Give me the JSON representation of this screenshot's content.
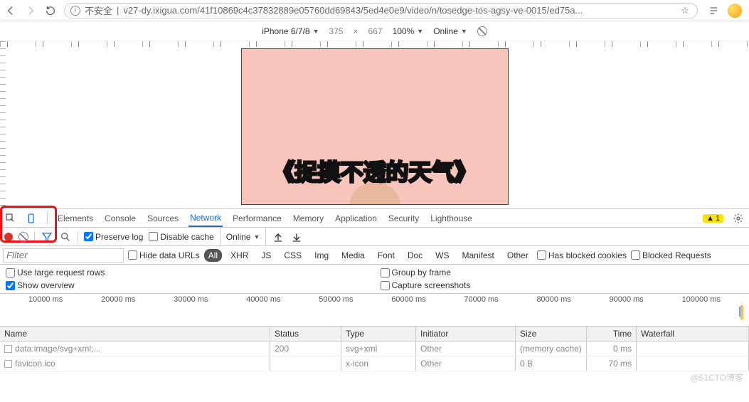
{
  "browser": {
    "insecure": "不安全",
    "url": "v27-dy.ixigua.com/41f10869c4c37832889e05760dd69843/5ed4e0e9/video/n/tosedge-tos-agsy-ve-0015/ed75a..."
  },
  "device_bar": {
    "device": "iPhone 6/7/8",
    "w": "375",
    "h": "667",
    "zoom": "100%",
    "throttle": "Online"
  },
  "video": {
    "title": "《捉摸不透的天气》"
  },
  "tabs": [
    "Elements",
    "Console",
    "Sources",
    "Network",
    "Performance",
    "Memory",
    "Application",
    "Security",
    "Lighthouse"
  ],
  "active_tab": "Network",
  "warn_count": "1",
  "controls": {
    "preserve": "Preserve log",
    "disable_cache": "Disable cache",
    "throttle": "Online"
  },
  "filter": {
    "placeholder": "Filter",
    "hide_data_urls": "Hide data URLs",
    "types": [
      "All",
      "XHR",
      "JS",
      "CSS",
      "Img",
      "Media",
      "Font",
      "Doc",
      "WS",
      "Manifest",
      "Other"
    ],
    "blocked_cookies": "Has blocked cookies",
    "blocked_req": "Blocked Requests"
  },
  "options": {
    "large_rows": "Use large request rows",
    "show_overview": "Show overview",
    "group_frame": "Group by frame",
    "capture_ss": "Capture screenshots"
  },
  "timeline": [
    "10000 ms",
    "20000 ms",
    "30000 ms",
    "40000 ms",
    "50000 ms",
    "60000 ms",
    "70000 ms",
    "80000 ms",
    "90000 ms",
    "100000 ms"
  ],
  "table": {
    "headers": [
      "Name",
      "Status",
      "Type",
      "Initiator",
      "Size",
      "Time",
      "Waterfall"
    ],
    "rows": [
      {
        "name": "data:image/svg+xml;...",
        "status": "200",
        "type": "svg+xml",
        "initiator": "Other",
        "size": "(memory cache)",
        "time": "0 ms"
      },
      {
        "name": "favicon.ico",
        "status": "",
        "type": "x-icon",
        "initiator": "Other",
        "size": "0 B",
        "time": "70 ms"
      }
    ]
  },
  "watermark": "@51CTO博客"
}
